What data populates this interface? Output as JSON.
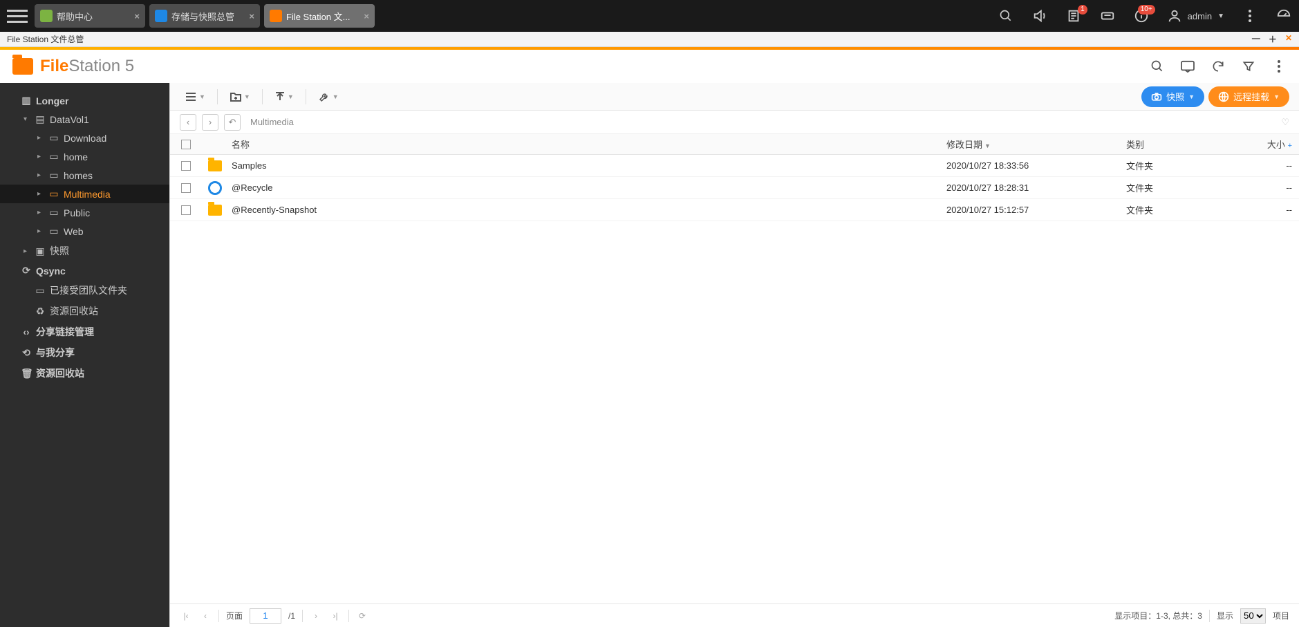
{
  "sysbar": {
    "tabs": [
      {
        "label": "帮助中心",
        "icon_color": "#7cb342",
        "active": false
      },
      {
        "label": "存储与快照总管",
        "icon_color": "#1e88e5",
        "active": false
      },
      {
        "label": "File Station 文...",
        "icon_color": "#ff7a00",
        "active": true
      }
    ],
    "notify_badge": "1",
    "info_badge": "10+",
    "username": "admin"
  },
  "window": {
    "title": "File Station 文件总管"
  },
  "app": {
    "brand_bold": "File",
    "brand_thin": "Station 5"
  },
  "toolbar": {
    "snapshot_label": "快照",
    "remote_label": "远程挂载"
  },
  "breadcrumb": "Multimedia",
  "sidebar": {
    "root": "Longer",
    "vol": "DataVol1",
    "folders": [
      "Download",
      "home",
      "homes",
      "Multimedia",
      "Public",
      "Web"
    ],
    "active_folder": "Multimedia",
    "snapshot": "快照",
    "qsync": "Qsync",
    "qsync_items": [
      "已接受团队文件夹",
      "资源回收站"
    ],
    "share_link": "分享链接管理",
    "share_me": "与我分享",
    "recycle": "资源回收站"
  },
  "columns": {
    "name": "名称",
    "date": "修改日期",
    "type": "类别",
    "size": "大小"
  },
  "rows": [
    {
      "name": "Samples",
      "date": "2020/10/27 18:33:56",
      "type": "文件夹",
      "icon": "folder"
    },
    {
      "name": "@Recycle",
      "date": "2020/10/27 18:28:31",
      "type": "文件夹",
      "icon": "recycle"
    },
    {
      "name": "@Recently-Snapshot",
      "date": "2020/10/27 15:12:57",
      "type": "文件夹",
      "icon": "folder"
    }
  ],
  "footer": {
    "page_label": "页面",
    "page_current": "1",
    "page_total": "/1",
    "range": "显示项目：1-3, 总共：3",
    "show_label": "显示",
    "per_page": "50",
    "items_label": "项目"
  }
}
